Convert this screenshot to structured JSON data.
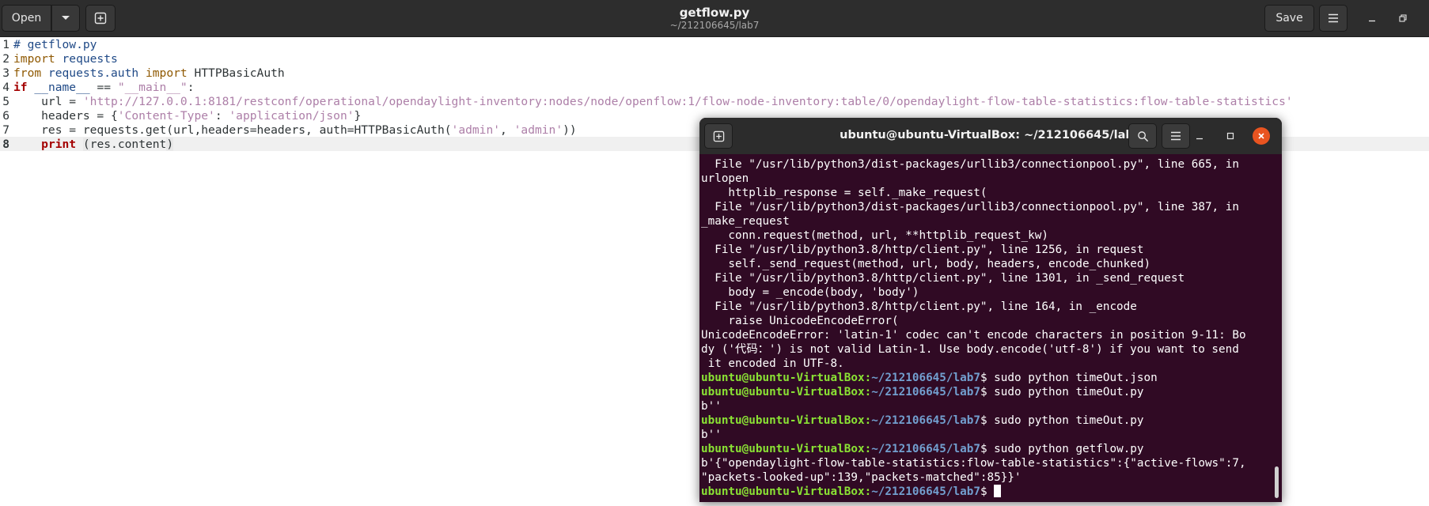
{
  "header": {
    "open_label": "Open",
    "save_label": "Save",
    "title": "getflow.py",
    "subtitle": "~/212106645/lab7"
  },
  "editor": {
    "line_numbers": [
      "1",
      "2",
      "3",
      "4",
      "5",
      "6",
      "7",
      "8"
    ],
    "lines": [
      {
        "t": [
          [
            "cm",
            "# getflow.py"
          ]
        ]
      },
      {
        "t": [
          [
            "kw2",
            "import"
          ],
          [
            "",
            ""
          ],
          [
            "id",
            " requests"
          ]
        ]
      },
      {
        "t": [
          [
            "kw2",
            "from"
          ],
          [
            "id",
            " requests.auth"
          ],
          [
            "",
            " "
          ],
          [
            "kw2",
            "import"
          ],
          [
            "",
            " HTTPBasicAuth"
          ]
        ]
      },
      {
        "t": [
          [
            "kw",
            "if"
          ],
          [
            "",
            " "
          ],
          [
            "id",
            "__name__"
          ],
          [
            "",
            " == "
          ],
          [
            "str",
            "\"__main__\""
          ],
          [
            "",
            ":"
          ]
        ]
      },
      {
        "t": [
          [
            "",
            "    url = "
          ],
          [
            "str",
            "'http://127.0.0.1:8181/restconf/operational/opendaylight-inventory:nodes/node/openflow:1/flow-node-inventory:table/0/opendaylight-flow-table-statistics:flow-table-statistics'"
          ]
        ]
      },
      {
        "t": [
          [
            "",
            "    headers = {"
          ],
          [
            "str",
            "'Content-Type'"
          ],
          [
            "",
            ": "
          ],
          [
            "str",
            "'application/json'"
          ],
          [
            "",
            "}"
          ]
        ]
      },
      {
        "t": [
          [
            "",
            "    res = requests.get(url,headers=headers, auth=HTTPBasicAuth("
          ],
          [
            "str",
            "'admin'"
          ],
          [
            "",
            ", "
          ],
          [
            "str",
            "'admin'"
          ],
          [
            "",
            "))"
          ]
        ]
      },
      {
        "t": [
          [
            "",
            "    "
          ],
          [
            "kw",
            "print"
          ],
          [
            "",
            " "
          ],
          [
            "bm",
            "("
          ],
          [
            "",
            "res.content"
          ],
          [
            "bm",
            ")"
          ]
        ]
      }
    ]
  },
  "terminal": {
    "title": "ubuntu@ubuntu-VirtualBox: ~/212106645/lab7",
    "prompt_user": "ubuntu@ubuntu-VirtualBox",
    "prompt_path": "~/212106645/lab7",
    "lines": [
      {
        "text": "  File \"/usr/lib/python3/dist-packages/urllib3/connectionpool.py\", line 665, in"
      },
      {
        "text": "urlopen"
      },
      {
        "text": "    httplib_response = self._make_request("
      },
      {
        "text": "  File \"/usr/lib/python3/dist-packages/urllib3/connectionpool.py\", line 387, in"
      },
      {
        "text": "_make_request"
      },
      {
        "text": "    conn.request(method, url, **httplib_request_kw)"
      },
      {
        "text": "  File \"/usr/lib/python3.8/http/client.py\", line 1256, in request"
      },
      {
        "text": "    self._send_request(method, url, body, headers, encode_chunked)"
      },
      {
        "text": "  File \"/usr/lib/python3.8/http/client.py\", line 1301, in _send_request"
      },
      {
        "text": "    body = _encode(body, 'body')"
      },
      {
        "text": "  File \"/usr/lib/python3.8/http/client.py\", line 164, in _encode"
      },
      {
        "text": "    raise UnicodeEncodeError("
      },
      {
        "text": "UnicodeEncodeError: 'latin-1' codec can't encode characters in position 9-11: Bo"
      },
      {
        "text": "dy ('代码：') is not valid Latin-1. Use body.encode('utf-8') if you want to send"
      },
      {
        "text": " it encoded in UTF-8."
      },
      {
        "prompt": true,
        "cmd": "sudo python timeOut.json"
      },
      {
        "prompt": true,
        "cmd": "sudo python timeOut.py"
      },
      {
        "text": "b''"
      },
      {
        "prompt": true,
        "cmd": "sudo python timeOut.py"
      },
      {
        "text": "b''"
      },
      {
        "prompt": true,
        "cmd": "sudo python getflow.py"
      },
      {
        "text": "b'{\"opendaylight-flow-table-statistics:flow-table-statistics\":{\"active-flows\":7,"
      },
      {
        "text": "\"packets-looked-up\":139,\"packets-matched\":85}}'"
      },
      {
        "prompt": true,
        "cmd": "",
        "cursor": true
      }
    ]
  }
}
